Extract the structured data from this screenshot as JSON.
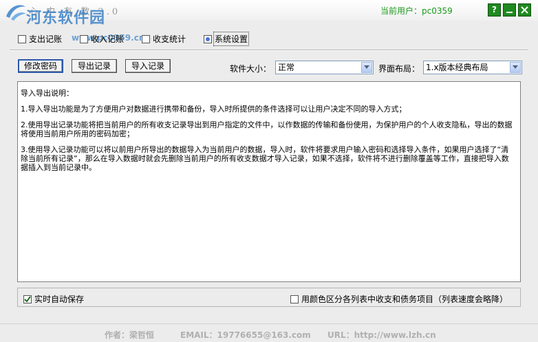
{
  "window": {
    "app_title": "心 中 有 数  2.0",
    "current_user_label": "当前用户：pc0359",
    "help_button": "?",
    "watermark_site": "河东软件园",
    "watermark_url": "www.pc0359.cn"
  },
  "tabs": [
    {
      "label": "支出记账",
      "checked": false
    },
    {
      "label": "收入记账",
      "checked": false
    },
    {
      "label": "收支统计",
      "checked": false
    },
    {
      "label": "系统设置",
      "checked": true
    }
  ],
  "toolbar": {
    "change_password": "修改密码",
    "export_records": "导出记录",
    "import_records": "导入记录",
    "size_label": "软件大小：",
    "size_value": "正常",
    "layout_label": "界面布局：",
    "layout_value": "1.x版本经典布局"
  },
  "instructions": {
    "heading": "导入导出说明：",
    "p1": "1.导入导出功能是为了方便用户对数据进行携带和备份，导入时所提供的条件选择可以让用户决定不同的导入方式；",
    "p2": "2.使用导出记录功能将把当前用户的所有收支记录导出到用户指定的文件中，以作数据的传输和备份使用，为保护用户的个人收支隐私，导出的数据将使用当前用户所用的密码加密；",
    "p3": "3.使用导入记录功能可以将以前用户所导出的数据导入为当前用户的数据，导入时，软件将要求用户输入密码和选择导入条件，如果用户选择了“清除当前所有记录”，那么在导入数据时就会先删除当前用户的所有收支数据才导入记录，如果不选择，软件将不进行删除覆盖等工作，直接把导入数据插入到当前记录中。"
  },
  "options": {
    "autosave_label": "实时自动保存",
    "autosave_checked": true,
    "color_label": "用颜色区分各列表中收支和债务项目（列表速度会略降）",
    "color_checked": false
  },
  "footer": {
    "author": "作者：梁哲恒",
    "email": "EMAIL：19776655@163.com",
    "url": "URL：http://www.lzh.cn"
  }
}
